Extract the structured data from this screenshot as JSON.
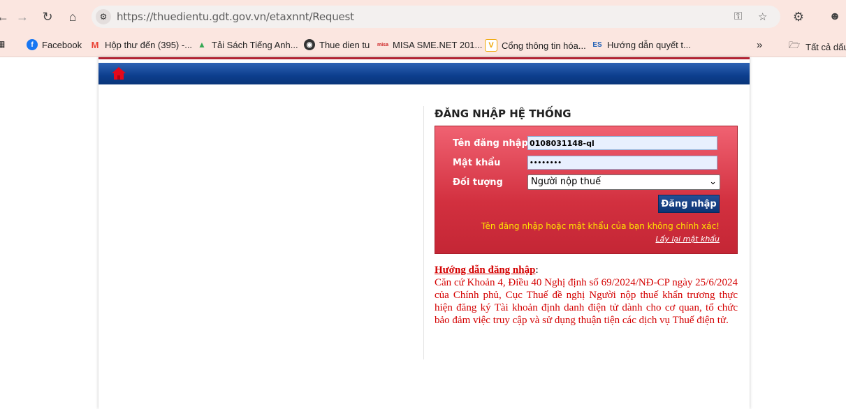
{
  "browser": {
    "url": "https://thuedientu.gdt.gov.vn/etaxnnt/Request",
    "bookmarks": [
      {
        "label": "Facebook",
        "icon": "facebook-icon",
        "color": "#1877f2"
      },
      {
        "label": "Hộp thư đến (395) -...",
        "icon": "gmail-icon",
        "color": "#ea4335"
      },
      {
        "label": "Tải Sách Tiếng Anh...",
        "icon": "drive-icon",
        "color": "#34a853"
      },
      {
        "label": "Thue dien tu",
        "icon": "globe-icon",
        "color": "#222222"
      },
      {
        "label": "MISA SME.NET 201...",
        "icon": "misa-icon",
        "color": "#cc1f1f"
      },
      {
        "label": "Cổng thông tin hóa...",
        "icon": "v-icon",
        "color": "#f0a500"
      },
      {
        "label": "Hướng dẫn quyết t...",
        "icon": "es-icon",
        "color": "#1f5fb5"
      }
    ],
    "all_bookmarks": "Tất cả dấu"
  },
  "login": {
    "title": "ĐĂNG NHẬP HỆ THỐNG",
    "username_label": "Tên đăng nhập",
    "username_value": "0108031148-ql",
    "password_label": "Mật khẩu",
    "password_value": "••••••••",
    "object_label": "Đối tượng",
    "object_value": "Người nộp thuế",
    "submit": "Đăng nhập",
    "error": "Tên đăng nhập hoặc mật khẩu của bạn không chính xác!",
    "forgot": "Lấy lại mật khẩu"
  },
  "guide": {
    "title": "Hướng dẫn đăng nhập",
    "colon": ":",
    "body": "Căn cứ Khoản 4, Điều 40 Nghị định số 69/2024/NĐ-CP ngày 25/6/2024 của Chính phủ, Cục Thuế đề nghị Người nộp thuế khẩn trương thực hiện đăng ký Tài khoản định danh điện tử dành cho cơ quan, tổ chức bảo đảm việc truy cập và sử dụng thuận tiện các dịch vụ Thuế điện tử."
  }
}
